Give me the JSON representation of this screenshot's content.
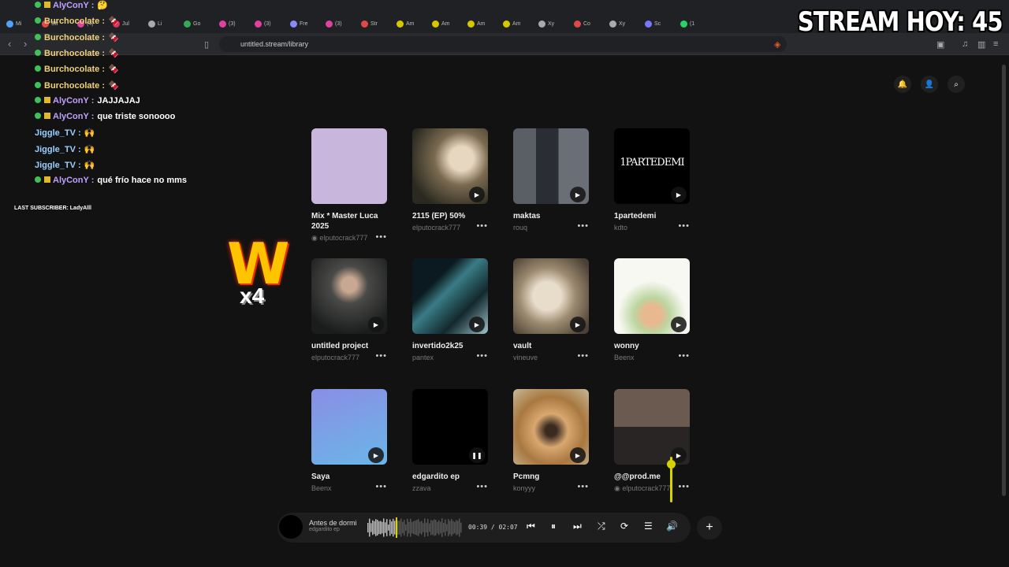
{
  "browser": {
    "tabs": [
      "Mi",
      "Str",
      "(4)",
      "Jul",
      "Li",
      "Go",
      "(3)",
      "(3)",
      "Fre",
      "(3)",
      "Str",
      "Am",
      "Am",
      "Am",
      "Am",
      "Xy",
      "Co",
      "Xy",
      "Sc",
      "(1"
    ],
    "url": "untitled.stream/library"
  },
  "overlay": {
    "stream_counter": "STREAM HOY: 45",
    "last_subscriber": "LAST SUBSCRIBER: LadyAlll",
    "emote_letter": "W",
    "emote_multiplier": "x4",
    "chat": [
      {
        "user": "AlyConY :",
        "msg": "🤔",
        "color": "p",
        "badge": "both"
      },
      {
        "user": "Burchocolate :",
        "msg": "🍫",
        "color": "y",
        "badge": "g"
      },
      {
        "user": "Burchocolate :",
        "msg": "🍫",
        "color": "y",
        "badge": "g"
      },
      {
        "user": "Burchocolate :",
        "msg": "🍫",
        "color": "y",
        "badge": "g"
      },
      {
        "user": "Burchocolate :",
        "msg": "🍫",
        "color": "y",
        "badge": "g"
      },
      {
        "user": "Burchocolate :",
        "msg": "🍫",
        "color": "y",
        "badge": "g"
      },
      {
        "user": "AlyConY :",
        "msg": "JAJJAJAJ",
        "color": "p",
        "badge": "both"
      },
      {
        "user": "AlyConY :",
        "msg": "que triste sonoooo",
        "color": "p",
        "badge": "both"
      },
      {
        "user": "Jiggle_TV :",
        "msg": "🙌",
        "color": "b",
        "badge": "none"
      },
      {
        "user": "Jiggle_TV :",
        "msg": "🙌",
        "color": "b",
        "badge": "none"
      },
      {
        "user": "Jiggle_TV :",
        "msg": "🙌",
        "color": "b",
        "badge": "none"
      },
      {
        "user": "AlyConY :",
        "msg": "qué frío hace no mms",
        "color": "p",
        "badge": "both"
      }
    ]
  },
  "library": {
    "items": [
      {
        "title": "Mix * Master Luca 2025",
        "sub": "elputocrack777",
        "cover": "lavender",
        "state": "none",
        "verified": true
      },
      {
        "title": "2115 (EP) 50%",
        "sub": "elputocrack777",
        "cover": "photo-hair",
        "state": "play"
      },
      {
        "title": "maktas",
        "sub": "rouq",
        "cover": "photo-suits",
        "state": "play"
      },
      {
        "title": "1partedemi",
        "sub": "kdto",
        "cover": "text-black",
        "cover_text": "1PARTEDEMI",
        "state": "play"
      },
      {
        "title": "untitled project",
        "sub": "elputocrack777",
        "cover": "photo-girl",
        "state": "play"
      },
      {
        "title": "invertido2k25",
        "sub": "pantex",
        "cover": "photo-teal",
        "state": "play"
      },
      {
        "title": "vault",
        "sub": "vineuve",
        "cover": "photo-cat",
        "state": "play"
      },
      {
        "title": "wonny",
        "sub": "Beenx",
        "cover": "photo-angel",
        "state": "play"
      },
      {
        "title": "Saya",
        "sub": "Beenx",
        "cover": "blue-gradient",
        "state": "play"
      },
      {
        "title": "edgardito ep",
        "sub": "zzava",
        "cover": "black",
        "state": "pause"
      },
      {
        "title": "Pcmng",
        "sub": "konyyy",
        "cover": "photo-dog",
        "state": "play"
      },
      {
        "title": "@@prod.me",
        "sub": "elputocrack777",
        "cover": "photo-friends",
        "state": "play",
        "verified": true
      }
    ]
  },
  "player": {
    "title": "Antes de dormi",
    "subtitle": "edgardito ep",
    "time": "00:39 / 02:07",
    "progress": 0.3,
    "volume": 0.85
  },
  "colors": {
    "accent": "#d6d200",
    "background": "#121212",
    "card": "#1e1e1e"
  }
}
